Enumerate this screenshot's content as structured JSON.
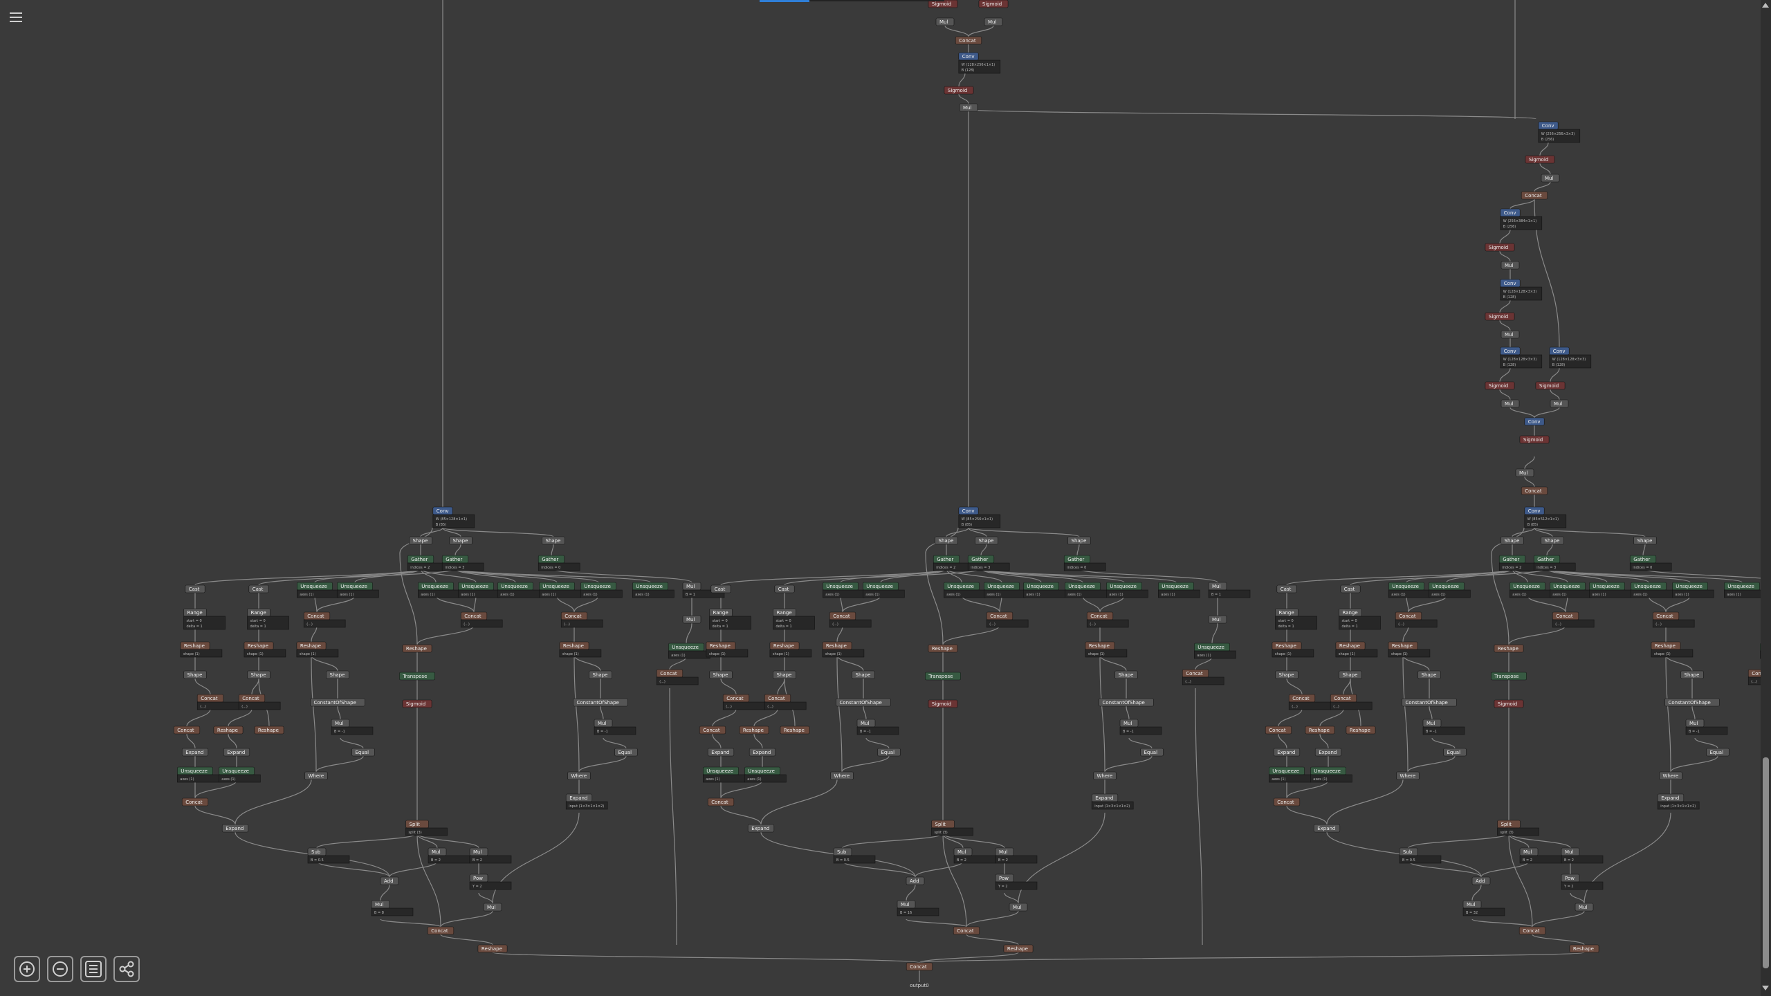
{
  "menu": {
    "icon": "hamburger-menu-icon"
  },
  "toolbar": {
    "buttons": [
      {
        "name": "zoom-in",
        "icon": "zoom-in-icon"
      },
      {
        "name": "zoom-out",
        "icon": "zoom-out-icon"
      },
      {
        "name": "properties",
        "icon": "list-icon"
      },
      {
        "name": "export",
        "icon": "share-icon"
      }
    ]
  },
  "colors": {
    "background": "#3a3a3a",
    "conv_header": "#3e5a8a",
    "activation_header": "#6b3434",
    "shape_header": "#555555",
    "transform_header": "#375a42",
    "tensor_header": "#6a4a3e",
    "edge": "#8a8a8a",
    "scroll_indicator": "#2f7fd8"
  },
  "graph": {
    "output_label": "output0",
    "nodes": [
      {
        "label": "Sigmoid",
        "type": "act"
      },
      {
        "label": "Sigmoid",
        "type": "act"
      },
      {
        "label": "Mul",
        "type": "math"
      },
      {
        "label": "Mul",
        "type": "math"
      },
      {
        "label": "Concat",
        "type": "tensor"
      },
      {
        "label": "Conv",
        "type": "conv",
        "attrs": [
          "W (128×256×1×1)",
          "B (128)"
        ]
      },
      {
        "label": "Sigmoid",
        "type": "act"
      },
      {
        "label": "Mul",
        "type": "math"
      },
      {
        "label": "Conv",
        "type": "conv",
        "attrs": [
          "W (256×256×3×3)",
          "B (256)"
        ]
      },
      {
        "label": "Sigmoid",
        "type": "act"
      },
      {
        "label": "Mul",
        "type": "math"
      },
      {
        "label": "Concat",
        "type": "tensor"
      },
      {
        "label": "Conv",
        "type": "conv",
        "attrs": [
          "W (256×384×1×1)",
          "B (256)"
        ]
      },
      {
        "label": "Sigmoid",
        "type": "act"
      },
      {
        "label": "Mul",
        "type": "math"
      },
      {
        "label": "Conv",
        "type": "conv",
        "attrs": [
          "W (128×128×3×3)",
          "B (128)"
        ]
      },
      {
        "label": "Sigmoid",
        "type": "act"
      },
      {
        "label": "Mul",
        "type": "math"
      },
      {
        "label": "Conv",
        "type": "conv",
        "attrs": [
          "W (128×128×3×3)",
          "B (128)"
        ]
      },
      {
        "label": "Sigmoid",
        "type": "act"
      },
      {
        "label": "Mul",
        "type": "math"
      },
      {
        "label": "Conv",
        "type": "conv",
        "attrs": [
          "W (128×128×3×3)",
          "B (128)"
        ]
      },
      {
        "label": "Sigmoid",
        "type": "act"
      },
      {
        "label": "Mul",
        "type": "math"
      },
      {
        "label": "Conv",
        "type": "conv",
        "attrs": [
          "W (128×512×1×1)",
          "B (128)"
        ]
      },
      {
        "label": "Sigmoid",
        "type": "act"
      },
      {
        "label": "Mul",
        "type": "math"
      },
      {
        "label": "Concat",
        "type": "tensor"
      },
      {
        "label": "Conv",
        "type": "conv",
        "attrs": [
          "W (512×512×1×1)",
          "B (512)"
        ]
      },
      {
        "label": "Sigmoid",
        "type": "act"
      },
      {
        "label": "Mul",
        "type": "math"
      },
      {
        "label": "Conv",
        "type": "conv",
        "attrs": [
          "W (85×128×1×1)",
          "B (85)"
        ]
      },
      {
        "label": "Conv",
        "type": "conv",
        "attrs": [
          "W (85×256×1×1)",
          "B (85)"
        ]
      },
      {
        "label": "Conv",
        "type": "conv",
        "attrs": [
          "W (85×512×1×1)",
          "B (85)"
        ]
      },
      {
        "label": "Concat",
        "type": "tensor"
      }
    ],
    "branch_labels": {
      "shape": "Shape",
      "gather": "Gather",
      "gather_attr_a": "indices = 2",
      "gather_attr_b": "indices = 3",
      "gather_attr_c": "indices = 0",
      "cast": "Cast",
      "range": "Range",
      "range_attr": "start = 0",
      "range_attr2": "delta = 1",
      "unsqueeze": "Unsqueeze",
      "unsqueeze_attr": "axes (1)",
      "concat": "Concat",
      "concat_attr": "(...)",
      "reshape": "Reshape",
      "reshape_attr": "shape (1)",
      "transpose": "Transpose",
      "sigmoid": "Sigmoid",
      "constant_of_shape": "ConstantOfShape",
      "mul": "Mul",
      "mul_attr": "B = -1",
      "mul_attr_b": "B = 1",
      "equal": "Equal",
      "where": "Where",
      "expand": "Expand",
      "expand_attr": "input (1×3×1×1×2)",
      "split": "Split",
      "split_attr": "split (3)",
      "sub": "Sub",
      "sub_attr": "B = 0.5",
      "mul2_attr": "B = 2",
      "pow": "Pow",
      "pow_attr": "Y = 2",
      "add": "Add",
      "mul_stride_a": "B = 8",
      "mul_stride_b": "B = 16",
      "mul_stride_c": "B = 32"
    }
  }
}
